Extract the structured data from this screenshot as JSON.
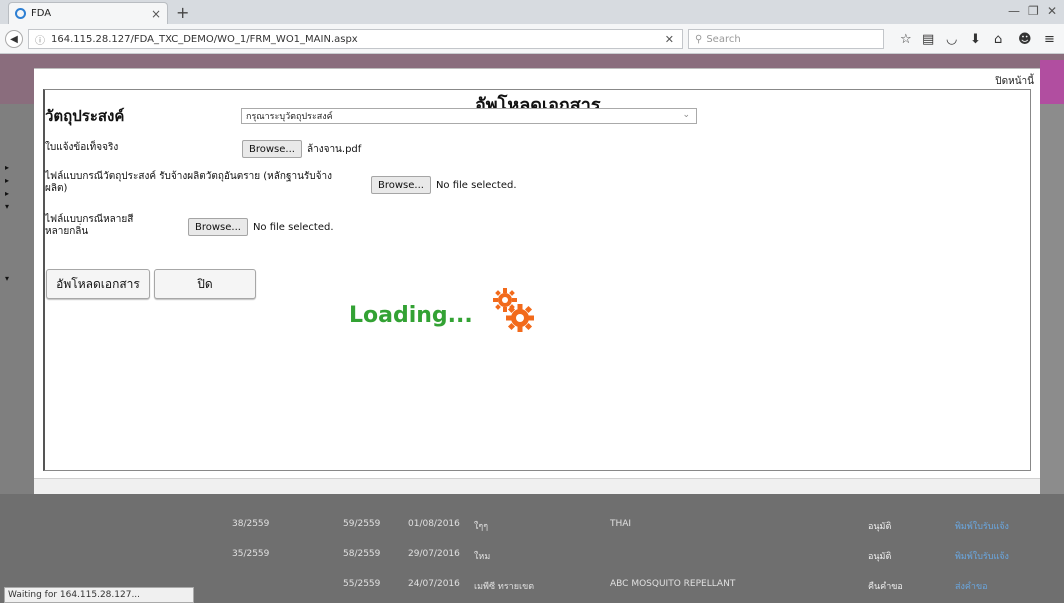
{
  "browser": {
    "tab_title": "FDA",
    "url": "164.115.28.127/FDA_TXC_DEMO/WO_1/FRM_WO1_MAIN.aspx",
    "search_placeholder": "Search",
    "status": "Waiting for 164.115.28.127..."
  },
  "modal": {
    "close_page_label": "ปิดหน้านี้",
    "title": "อัพโหลดเอกสาร",
    "purpose_label": "วัตถุประสงค์",
    "purpose_select_value": "กรุณาระบุวัตถุประสงค์",
    "fields": [
      {
        "label": "ใบแจ้งข้อเท็จจริง",
        "browse_label": "Browse...",
        "file_name": "ล้างจาน.pdf"
      },
      {
        "label_line1": "ไฟล์แบบกรณีวัตถุประสงค์ รับจ้างผลิตวัตถุอันตราย (หลักฐานรับจ้าง",
        "label_line2": "ผลิต)",
        "browse_label": "Browse...",
        "file_name": "No file selected."
      },
      {
        "label_line1": "ไฟล์แบบกรณีหลายสี",
        "label_line2": "หลายกลิ่น",
        "browse_label": "Browse...",
        "file_name": "No file selected."
      }
    ],
    "upload_button": "อัพโหลดเอกสาร",
    "close_button": "ปิด",
    "loading_text": "Loading..."
  },
  "background_rows": [
    {
      "c1": "38/2559",
      "c2": "59/2559",
      "date": "01/08/2016",
      "c4": "ใๆๆ",
      "product": "THAI",
      "status": "อนุมัติ",
      "link": "พิมพ์ใบรับแจ้ง"
    },
    {
      "c1": "35/2559",
      "c2": "58/2559",
      "date": "29/07/2016",
      "c4": "ใหม",
      "product": "",
      "status": "อนุมัติ",
      "link": "พิมพ์ใบรับแจ้ง"
    },
    {
      "c1": "",
      "c2": "55/2559",
      "date": "24/07/2016",
      "c4": "เมพีซี ทรายเขต",
      "product": "ABC MOSQUITO REPELLANT",
      "status": "คืนคำขอ",
      "link": "ส่งคำขอ"
    }
  ],
  "colors": {
    "loading_text": "#33a234",
    "gear": "#f26a1b",
    "link": "#6aa7e0"
  }
}
